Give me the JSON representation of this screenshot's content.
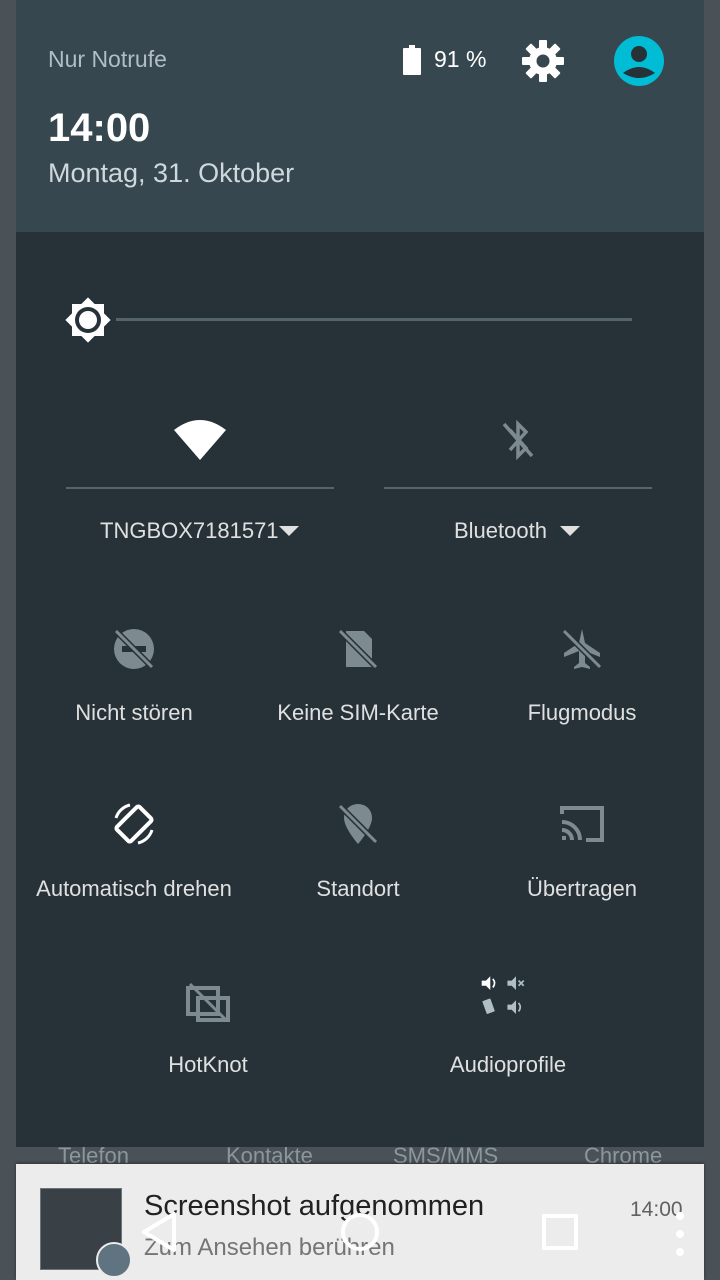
{
  "status": {
    "carrier": "Nur Notrufe",
    "battery_percent": "91 %",
    "time": "14:00",
    "date": "Montag, 31. Oktober"
  },
  "brightness": {
    "level": 0.0
  },
  "wifi": {
    "label": "TNGBOX7181571",
    "icon": "wifi-icon"
  },
  "bluetooth": {
    "label": "Bluetooth",
    "icon": "bluetooth-disabled-icon"
  },
  "tiles": [
    {
      "label": "Nicht stören",
      "icon": "do-not-disturb-off-icon"
    },
    {
      "label": "Keine SIM-Karte",
      "icon": "no-sim-icon"
    },
    {
      "label": "Flugmodus",
      "icon": "airplane-off-icon"
    },
    {
      "label": "Automatisch drehen",
      "icon": "auto-rotate-icon"
    },
    {
      "label": "Standort",
      "icon": "location-off-icon"
    },
    {
      "label": "Übertragen",
      "icon": "cast-icon"
    },
    {
      "label": "HotKnot",
      "icon": "hotknot-icon"
    },
    {
      "label": "Audioprofile",
      "icon": "audio-profiles-icon"
    }
  ],
  "dock": {
    "apps": [
      "Telefon",
      "Kontakte",
      "SMS/MMS",
      "Chrome"
    ]
  },
  "notification": {
    "title": "Screenshot aufgenommen",
    "subtitle": "Zum Ansehen berühren",
    "time": "14:00"
  },
  "colors": {
    "panel": "#263238",
    "header": "#37474f",
    "accent": "#00bcd4"
  }
}
